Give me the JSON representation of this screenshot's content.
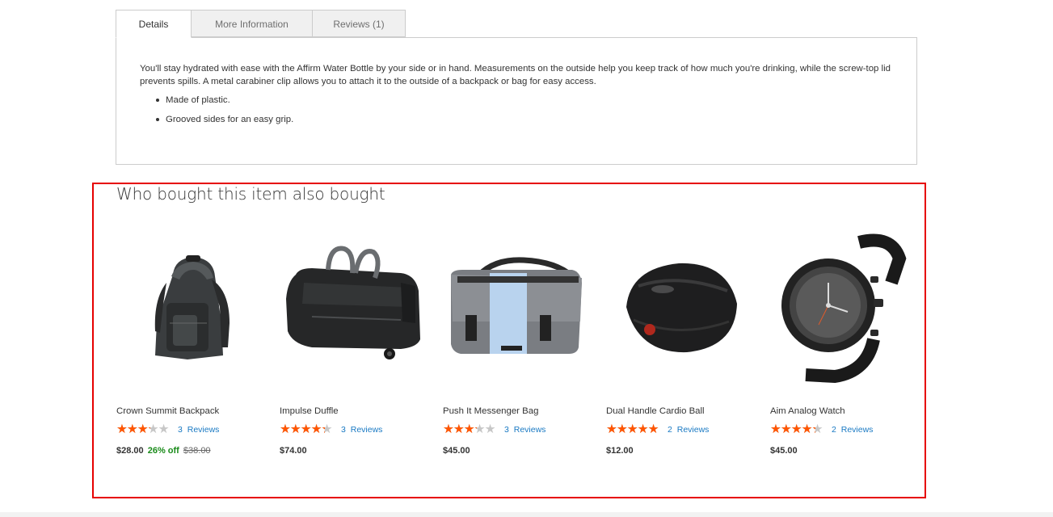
{
  "tabs": [
    {
      "label": "Details",
      "active": true
    },
    {
      "label": "More Information",
      "active": false
    },
    {
      "label": "Reviews (1)",
      "active": false
    }
  ],
  "details": {
    "description": "You'll stay hydrated with ease with the Affirm Water Bottle by your side or in hand. Measurements on the outside help you keep track of how much you're drinking, while the screw-top lid prevents spills. A metal carabiner clip allows you to attach it to the outside of a backpack or bag for easy access.",
    "bullets": [
      "Made of plastic.",
      "Grooved sides for an easy grip."
    ]
  },
  "related": {
    "title": "Who bought this item also bought",
    "products": [
      {
        "name": "Crown Summit Backpack",
        "rating_fraction": 0.6,
        "reviews_label": "3 Reviews",
        "price": "$28.00",
        "discount": "26% off",
        "old_price": "$38.00",
        "image_icon": "backpack-image"
      },
      {
        "name": "Impulse Duffle",
        "rating_fraction": 0.8,
        "reviews_label": "3 Reviews",
        "price": "$74.00",
        "discount": "",
        "old_price": "",
        "image_icon": "duffle-bag-image"
      },
      {
        "name": "Push It Messenger Bag",
        "rating_fraction": 0.6,
        "reviews_label": "3 Reviews",
        "price": "$45.00",
        "discount": "",
        "old_price": "",
        "image_icon": "messenger-bag-image"
      },
      {
        "name": "Dual Handle Cardio Ball",
        "rating_fraction": 1.0,
        "reviews_label": "2 Reviews",
        "price": "$12.00",
        "discount": "",
        "old_price": "",
        "image_icon": "cardio-ball-image"
      },
      {
        "name": "Aim Analog Watch",
        "rating_fraction": 0.8,
        "reviews_label": "2 Reviews",
        "price": "$45.00",
        "discount": "",
        "old_price": "",
        "image_icon": "analog-watch-image"
      }
    ]
  },
  "colors": {
    "star": "#ff5501",
    "star_empty": "#c7c7c7",
    "link": "#1979c3",
    "discount": "#1a8b1a",
    "highlight_border": "#e60000"
  }
}
